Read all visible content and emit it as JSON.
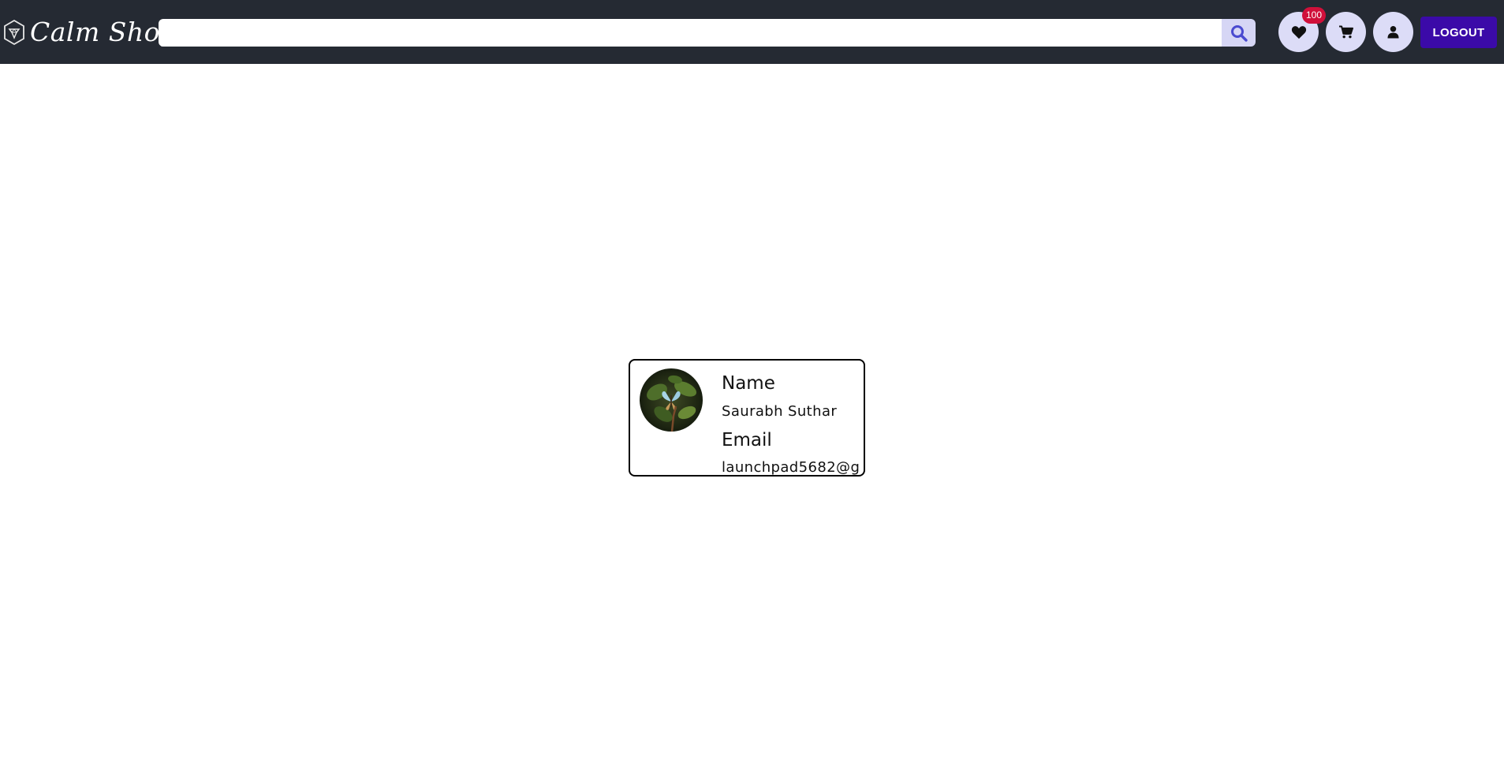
{
  "header": {
    "brand_name": "Calm Shop",
    "brand_icon": "diamond-shield-icon",
    "search": {
      "value": "",
      "placeholder": "",
      "button_icon": "search-icon"
    },
    "wishlist": {
      "icon": "heart-icon",
      "count": "100"
    },
    "cart": {
      "icon": "cart-icon"
    },
    "account": {
      "icon": "user-icon"
    },
    "logout_label": "LOGOUT"
  },
  "profile": {
    "avatar": "butterfly-photo",
    "name_label": "Name",
    "name_value": "Saurabh Suthar",
    "email_label": "Email",
    "email_value": "launchpad5682@g"
  },
  "colors": {
    "navbar_bg": "#252a33",
    "icon_button_bg": "#dcdcf7",
    "badge_bg": "#d0103a",
    "logout_bg": "#3b0aa8",
    "search_icon": "#4a4ad0"
  }
}
